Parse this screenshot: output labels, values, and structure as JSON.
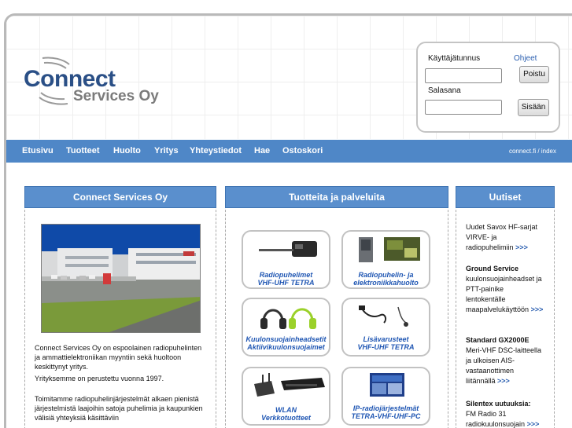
{
  "logo": {
    "main": "Connect",
    "sub": "Services Oy"
  },
  "login": {
    "username_label": "Käyttäjätunnus",
    "help_link": "Ohjeet",
    "logout_button": "Poistu",
    "password_label": "Salasana",
    "login_button": "Sisään",
    "username_value": "",
    "password_value": ""
  },
  "nav": {
    "items": [
      "Etusivu",
      "Tuotteet",
      "Huolto",
      "Yritys",
      "Yhteystiedot",
      "Hae",
      "Ostoskori"
    ],
    "crumb": "connect.fi / index"
  },
  "left": {
    "title": "Connect Services Oy",
    "p1": "Connect Services Oy on espoolainen radiopuhelinten ja ammattielektroniikan myyntiin sekä huoltoon keskittynyt yritys.",
    "p1b": "Yrityksemme on perustettu vuonna 1997.",
    "p2": "Toimitamme radiopuhelinjärjestelmät alkaen pienistä järjestelmistä laajoihin satoja puhelimia ja kaupunkien välisiä yhteyksiä käsittäviin"
  },
  "middle": {
    "title": "Tuotteita ja palveluita",
    "tiles": [
      {
        "line1": "Radiopuhelimet",
        "line2": "VHF-UHF TETRA"
      },
      {
        "line1": "Radiopuhelin- ja",
        "line2": "elektroniikkahuolto"
      },
      {
        "line1": "Kuulonsuojainheadsetit",
        "line2": "Aktiivikuulonsuojaimet"
      },
      {
        "line1": "Lisävarusteet",
        "line2": "VHF-UHF TETRA"
      },
      {
        "line1": "WLAN",
        "line2": "Verkkotuotteet"
      },
      {
        "line1": "IP-radiojärjestelmät",
        "line2": "TETRA-VHF-UHF-PC"
      }
    ]
  },
  "right": {
    "title": "Uutiset",
    "news": [
      {
        "heading": "",
        "text": "Uudet Savox HF-sarjat VIRVE- ja radiopuhelimiin",
        "more": ">>>"
      },
      {
        "heading": "Ground Service",
        "text": "kuulonsuojainheadset ja PTT-painike lentokentälle maapalvelukäyttöön",
        "more": ">>>"
      },
      {
        "heading": "Standard GX2000E",
        "text": "Meri-VHF DSC-laitteella ja ulkoisen AIS-vastaanottimen liitännällä",
        "more": ">>>"
      },
      {
        "heading": "Silentex uutuuksia:",
        "text": "FM Radio 31 radiokuulonsuojain",
        "more": ">>>"
      }
    ]
  }
}
